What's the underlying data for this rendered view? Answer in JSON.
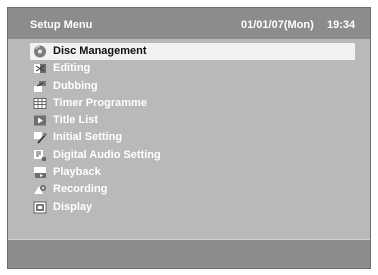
{
  "header": {
    "title": "Setup Menu",
    "date": "01/01/07(Mon)",
    "time": "19:34"
  },
  "menu": {
    "items": [
      {
        "label": "Disc Management",
        "icon": "disc-icon",
        "selected": true
      },
      {
        "label": "Editing",
        "icon": "editing-icon"
      },
      {
        "label": "Dubbing",
        "icon": "dubbing-icon"
      },
      {
        "label": "Timer Programme",
        "icon": "timer-icon"
      },
      {
        "label": "Title List",
        "icon": "title-list-icon"
      },
      {
        "label": "Initial Setting",
        "icon": "initial-setting-icon"
      },
      {
        "label": "Digital Audio Setting",
        "icon": "digital-audio-icon"
      },
      {
        "label": "Playback",
        "icon": "playback-icon"
      },
      {
        "label": "Recording",
        "icon": "recording-icon"
      },
      {
        "label": "Display",
        "icon": "display-icon"
      }
    ]
  },
  "colors": {
    "background": "#b9b9b9",
    "header": "#8c8c8c",
    "selected_row": "#f2f2f2",
    "text": "#ffffff"
  }
}
